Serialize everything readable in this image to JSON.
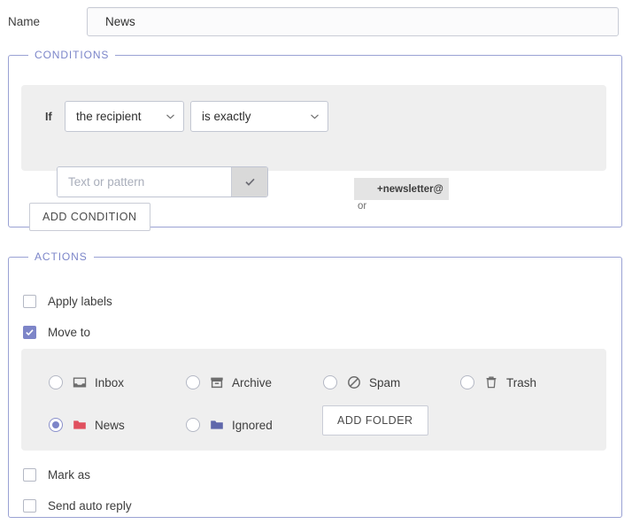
{
  "name_field": {
    "label": "Name",
    "value": "News",
    "placeholder": ""
  },
  "conditions": {
    "legend": "CONDITIONS",
    "if_label": "If",
    "field_select": {
      "value": "the recipient",
      "icon": "chevron-down-icon"
    },
    "operator_select": {
      "value": "is exactly",
      "icon": "chevron-down-icon"
    },
    "tag": "+newsletter@",
    "or_text": "or",
    "pattern_input": {
      "value": "",
      "placeholder": "Text or pattern"
    },
    "confirm_icon": "check-icon",
    "add_condition_label": "ADD CONDITION"
  },
  "actions": {
    "legend": "ACTIONS",
    "checkboxes": [
      {
        "label": "Apply labels",
        "checked": false
      },
      {
        "label": "Move to",
        "checked": true
      },
      {
        "label": "Mark as",
        "checked": false
      },
      {
        "label": "Send auto reply",
        "checked": false
      }
    ],
    "folders": [
      {
        "label": "Inbox",
        "icon": "inbox-icon",
        "selected": false,
        "color": "#6d6d6d"
      },
      {
        "label": "Archive",
        "icon": "archive-box-icon",
        "selected": false,
        "color": "#6d6d6d"
      },
      {
        "label": "Spam",
        "icon": "no-entry-icon",
        "selected": false,
        "color": "#6d6d6d"
      },
      {
        "label": "Trash",
        "icon": "trash-can-icon",
        "selected": false,
        "color": "#6d6d6d"
      },
      {
        "label": "News",
        "icon": "folder-icon",
        "selected": true,
        "color": "#e0505e"
      },
      {
        "label": "Ignored",
        "icon": "folder-icon",
        "selected": false,
        "color": "#5f67ab"
      }
    ],
    "add_folder_label": "ADD FOLDER"
  },
  "colors": {
    "accent": "#7d85c8",
    "legend": "#7b85c9",
    "panel_border": "#9aa2d4",
    "panel_fill": "#efefef",
    "news_folder": "#e0505e",
    "ignored_folder": "#5f67ab"
  }
}
